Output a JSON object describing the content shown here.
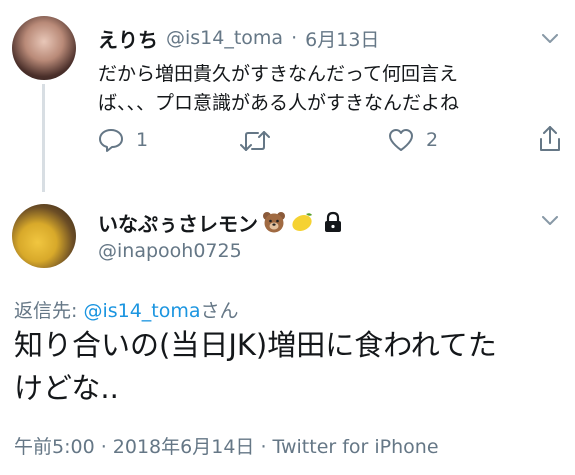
{
  "first_tweet": {
    "display_name": "えりち",
    "handle": "@is14_toma",
    "separator": "·",
    "date": "6月13日",
    "text_line1": "だから増田貴久がすきなんだって何回言え",
    "text_line2": "ば、、、プロ意識がある人がすきなんだよね",
    "reply_count": "1",
    "like_count": "2"
  },
  "second_tweet": {
    "display_name": "いなぷぅさレモン",
    "handle": "@inapooh0725",
    "reply_prefix": "返信先: ",
    "reply_handle": "@is14_toma",
    "reply_suffix": "さん",
    "text_line1": "知り合いの(当日JK)増田に食われてた",
    "text_line2": "けどな..",
    "timestamp": "午前5:00 · 2018年6月14日 · Twitter for iPhone"
  },
  "colors": {
    "text": "#14171a",
    "muted": "#657786",
    "link": "#1b95e0",
    "thread_line": "#d8dee3"
  },
  "icons": [
    "chevron-down-icon",
    "reply-icon",
    "retweet-icon",
    "like-icon",
    "share-icon",
    "bear-emoji-icon",
    "lemon-emoji-icon",
    "lock-icon"
  ]
}
